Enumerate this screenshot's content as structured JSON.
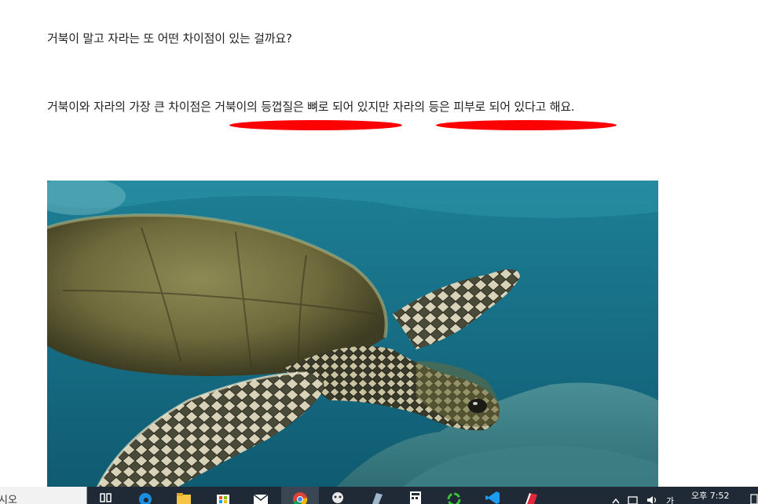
{
  "article": {
    "paragraph1": "거북이 말고 자라는 또 어떤 차이점이 있는 걸까요?",
    "paragraph2": "거북이와 자라의 가장 큰 차이점은 거북이의 등껍질은 뼈로 되어 있지만 자라의 등은 피부로 되어 있다고 해요.",
    "highlight_color": "#ff0000"
  },
  "taskbar": {
    "search_text": "시오",
    "clock": "오후 7:52",
    "ime": "가",
    "icons": [
      "task-view-icon",
      "edge-icon",
      "file-explorer-icon",
      "store-icon",
      "mail-icon",
      "chrome-icon",
      "app-icon",
      "app-icon-2",
      "calculator-icon",
      "app-icon-3",
      "vscode-icon",
      "app-icon-4"
    ]
  }
}
